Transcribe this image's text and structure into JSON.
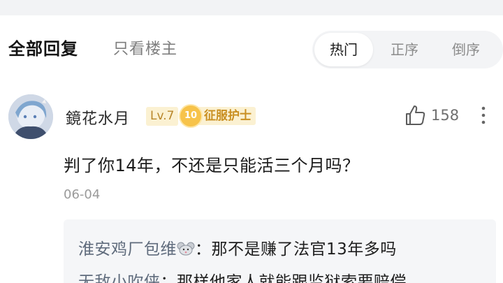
{
  "tabs": {
    "all_replies": "全部回复",
    "op_only": "只看楼主"
  },
  "sort": {
    "hot": "热门",
    "ascending": "正序",
    "descending": "倒序",
    "active": "hot"
  },
  "comment": {
    "username": "鏡花水月",
    "level": "Lv.7",
    "honor_level": "10",
    "honor_title": "征服护士",
    "like_count": "158",
    "text": "判了你14年，不还是只能活三个月吗？",
    "date": "06-04"
  },
  "replies": [
    {
      "user": "淮安鸡厂包维",
      "emoji": "mouse-icon",
      "separator": "：",
      "text": "那不是赚了法官13年多吗"
    },
    {
      "user": "无敌小吹侠",
      "separator": "：",
      "text": "那样他家人就能跟监狱索要赔偿"
    }
  ],
  "colors": {
    "badge_bg": "#fbf1d2",
    "badge_text": "#b8862a",
    "reply_user": "#5f6b7c",
    "segment_bg": "#f3f4f6"
  }
}
